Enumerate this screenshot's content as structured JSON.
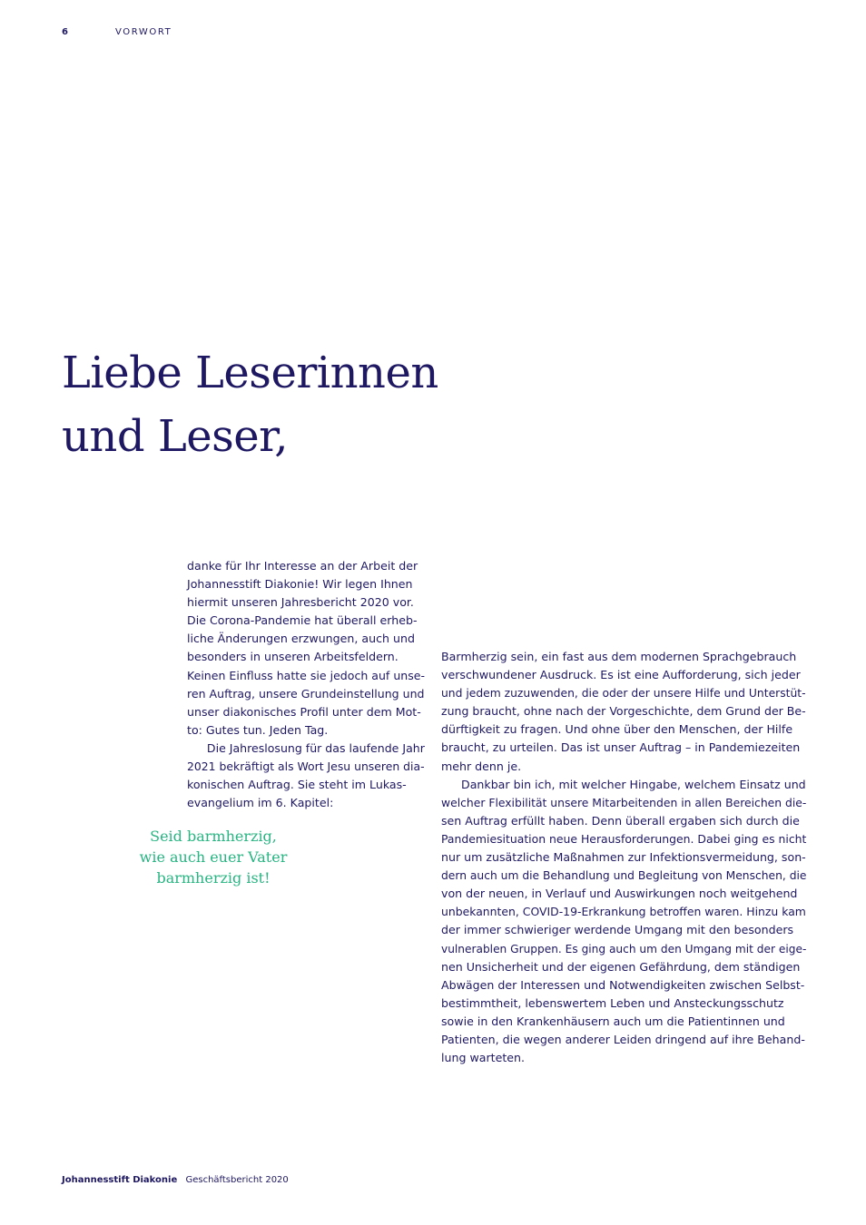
{
  "header": {
    "page_number": "6",
    "section": "VORWORT"
  },
  "headline": {
    "line1": "Liebe Leserinnen",
    "line2": "und Leser,"
  },
  "left_column": {
    "lines": [
      "danke für Ihr Interesse an der Arbeit der",
      "Johannesstift Diakonie! Wir legen Ihnen",
      "hiermit unseren Jahresbericht 2020 vor.",
      "Die Corona-Pandemie hat überall erheb-",
      "liche Änderungen erzwungen, auch und",
      "besonders in unseren Arbeitsfeldern.",
      "Keinen Einfluss hatte sie jedoch auf unse-",
      "ren Auftrag, unsere Grundeinstellung und",
      "unser diakonisches Profil unter dem Mot-",
      "to: Gutes tun. Jeden Tag.",
      "Die Jahreslosung für das laufende Jahr",
      "2021 bekräftigt als Wort Jesu unseren dia-",
      "konischen Auftrag. Sie steht im Lukas-",
      "evangelium im 6. Kapitel:"
    ]
  },
  "quote": {
    "line1": "Seid barmherzig,",
    "line2": "wie auch euer Vater",
    "line3": "barmherzig ist!"
  },
  "right_column": {
    "lines": [
      "Barmherzig sein, ein fast aus dem modernen Sprachgebrauch",
      "verschwundener Ausdruck. Es ist eine Aufforderung, sich jeder",
      "und jedem zuzuwenden, die oder der unsere Hilfe und Unterstüt-",
      "zung braucht, ohne nach der Vorgeschichte, dem Grund der Be-",
      "dürftigkeit zu fragen. Und ohne über den Menschen, der Hilfe",
      "braucht, zu urteilen. Das ist unser Auftrag – in Pandemiezeiten",
      "mehr denn je.",
      "Dankbar bin ich, mit welcher Hingabe, welchem Einsatz und",
      "welcher Flexibilität unsere Mitarbeitenden in allen Bereichen die-",
      "sen Auftrag erfüllt haben. Denn überall ergaben sich durch die",
      "Pandemiesituation neue Herausforderungen. Dabei ging es nicht",
      "nur um zusätzliche Maßnahmen zur Infektionsvermeidung, son-",
      "dern auch um die Behandlung und Begleitung von Menschen, die",
      "von der neuen, in Verlauf und Auswirkungen noch weitgehend",
      "unbekannten, COVID-19-Erkrankung betroffen waren. Hinzu kam",
      "der immer schwieriger werdende Umgang mit den besonders",
      "vulnerablen Gruppen. Es ging auch um den Umgang mit der eige-",
      "nen Unsicherheit und der eigenen Gefährdung, dem ständigen",
      "Abwägen der Interessen und Notwendigkeiten zwischen Selbst-",
      "bestimmtheit, lebenswertem Leben und Ansteckungsschutz",
      "sowie in den Krankenhäusern auch um die Patientinnen und",
      "Patienten, die wegen anderer Leiden dringend auf ihre Behand-",
      "lung warteten."
    ]
  },
  "footer": {
    "organization": "Johannesstift Diakonie",
    "publication": "Geschäftsbericht 2020"
  }
}
